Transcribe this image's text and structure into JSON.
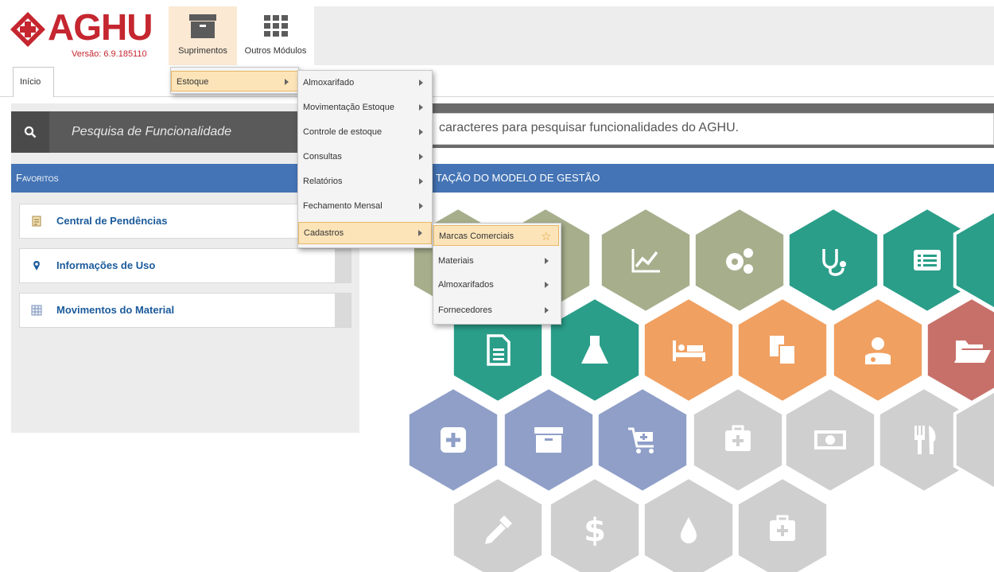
{
  "app": {
    "logo_text": "AGHU",
    "version": "Versão: 6.9.185110"
  },
  "modules": [
    {
      "label": "Suprimentos",
      "icon": "archive-box-icon"
    },
    {
      "label": "Outros Módulos",
      "icon": "grid-icon"
    }
  ],
  "tabs": [
    {
      "label": "Início"
    }
  ],
  "search": {
    "label": "Pesquisa de Funcionalidade",
    "hint": "caracteres para pesquisar funcionalidades do AGHU."
  },
  "favorites": {
    "title": "Favoritos",
    "items": [
      {
        "label": "Central de Pendências",
        "icon": "clipboard-icon"
      },
      {
        "label": "Informações de Uso",
        "icon": "map-pin-icon"
      },
      {
        "label": "Movimentos do Material",
        "icon": "spreadsheet-icon"
      }
    ]
  },
  "management": {
    "title": "tação do Modelo de Gestão"
  },
  "menu_level1": {
    "items": [
      {
        "label": "Estoque",
        "highlighted": true
      }
    ]
  },
  "menu_level2": {
    "items": [
      {
        "label": "Almoxarifado"
      },
      {
        "label": "Movimentação Estoque"
      },
      {
        "label": "Controle de estoque"
      },
      {
        "label": "Consultas"
      },
      {
        "label": "Relatórios"
      },
      {
        "label": "Fechamento Mensal"
      },
      {
        "label": "Cadastros",
        "highlighted": true
      }
    ]
  },
  "menu_level3": {
    "items": [
      {
        "label": "Marcas Comerciais",
        "highlighted": true,
        "icon": "star-icon"
      },
      {
        "label": "Materiais"
      },
      {
        "label": "Almoxarifados"
      },
      {
        "label": "Fornecedores"
      }
    ]
  },
  "hex_tiles": [
    {
      "name": "hex-olive-1",
      "icon": "none",
      "color": "#a6ae8c"
    },
    {
      "name": "hex-olive-2",
      "icon": "none",
      "color": "#a6ae8c"
    },
    {
      "name": "hex-chart",
      "icon": "line-chart-icon",
      "color": "#a6ae8c"
    },
    {
      "name": "hex-gears",
      "icon": "gears-icon",
      "color": "#a6ae8c"
    },
    {
      "name": "hex-stethoscope",
      "icon": "stethoscope-icon",
      "color": "#2a9e89"
    },
    {
      "name": "hex-list",
      "icon": "list-icon",
      "color": "#2a9e89"
    },
    {
      "name": "hex-teal-edge",
      "icon": "none",
      "color": "#2a9e89"
    },
    {
      "name": "hex-document",
      "icon": "document-icon",
      "color": "#2a9e89"
    },
    {
      "name": "hex-flask",
      "icon": "flask-icon",
      "color": "#2a9e89"
    },
    {
      "name": "hex-bed",
      "icon": "bed-icon",
      "color": "#f0a061"
    },
    {
      "name": "hex-copy",
      "icon": "copy-icon",
      "color": "#f0a061"
    },
    {
      "name": "hex-doctor",
      "icon": "doctor-icon",
      "color": "#f0a061"
    },
    {
      "name": "hex-folder",
      "icon": "folder-icon",
      "color": "#c77069"
    },
    {
      "name": "hex-plus",
      "icon": "plus-square-icon",
      "color": "#8f9fc8"
    },
    {
      "name": "hex-archive",
      "icon": "archive-icon",
      "color": "#8f9fc8"
    },
    {
      "name": "hex-cart",
      "icon": "cart-icon",
      "color": "#8f9fc8"
    },
    {
      "name": "hex-medkit",
      "icon": "medkit-icon",
      "color": "#cfcfcf"
    },
    {
      "name": "hex-money",
      "icon": "money-icon",
      "color": "#cfcfcf"
    },
    {
      "name": "hex-cutlery",
      "icon": "cutlery-icon",
      "color": "#cfcfcf"
    },
    {
      "name": "hex-gray-edge",
      "icon": "none",
      "color": "#cfcfcf"
    },
    {
      "name": "hex-eyedropper",
      "icon": "eyedropper-icon",
      "color": "#cfcfcf"
    },
    {
      "name": "hex-dollar",
      "icon": "dollar-icon",
      "color": "#cfcfcf"
    },
    {
      "name": "hex-drop",
      "icon": "drop-icon",
      "color": "#cfcfcf"
    },
    {
      "name": "hex-medkit-2",
      "icon": "medkit-icon",
      "color": "#cfcfcf"
    }
  ]
}
